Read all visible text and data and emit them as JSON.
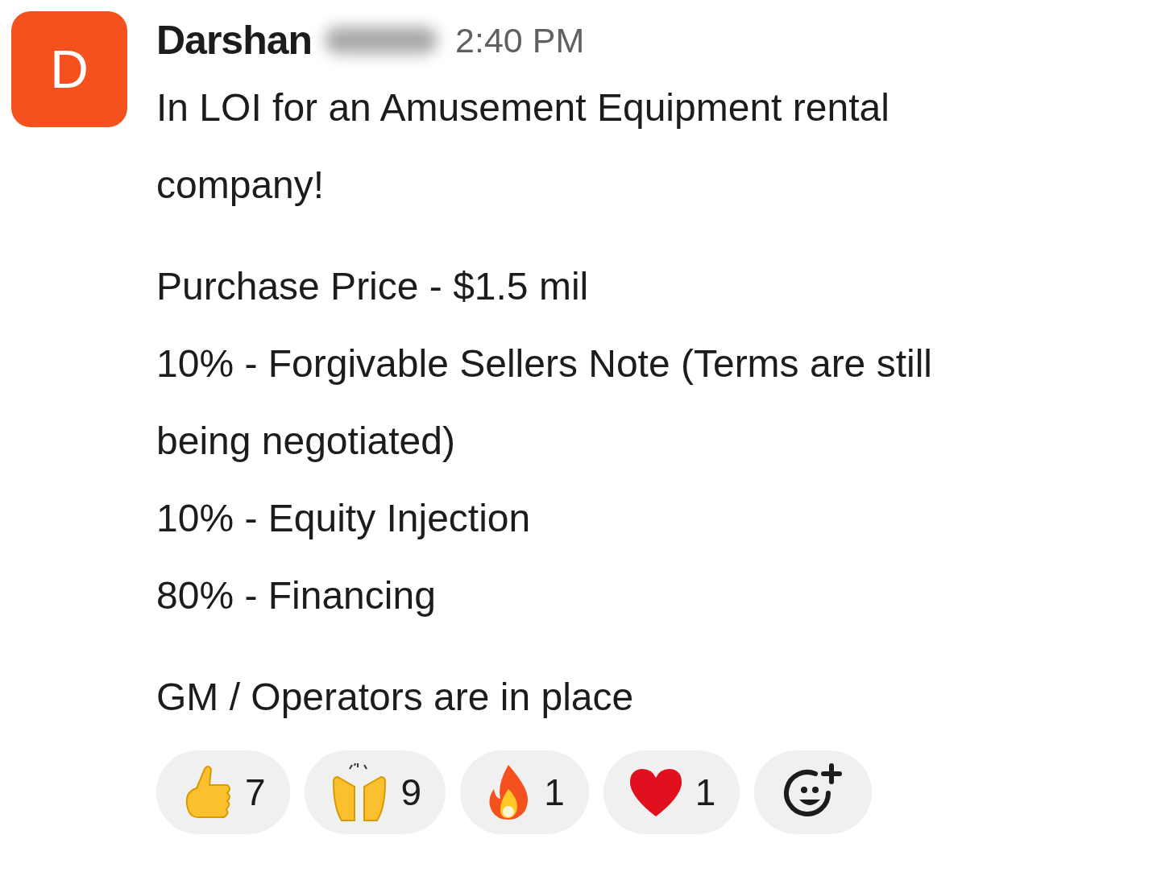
{
  "message": {
    "avatar_initial": "D",
    "author": "Darshan",
    "author_surname_blurred": true,
    "time": "2:40 PM",
    "paragraphs": [
      [
        "In LOI for an Amusement Equipment rental company!"
      ],
      [
        "Purchase Price - $1.5 mil",
        "10% - Forgivable Sellers Note (Terms are still being negotiated)",
        "10% - Equity Injection",
        "80% - Financing"
      ],
      [
        "GM / Operators are in place"
      ]
    ],
    "reactions": [
      {
        "kind": "thumbs-up",
        "count": "7"
      },
      {
        "kind": "raised-hands",
        "count": "9"
      },
      {
        "kind": "fire",
        "count": "1"
      },
      {
        "kind": "heart",
        "count": "1"
      }
    ]
  }
}
